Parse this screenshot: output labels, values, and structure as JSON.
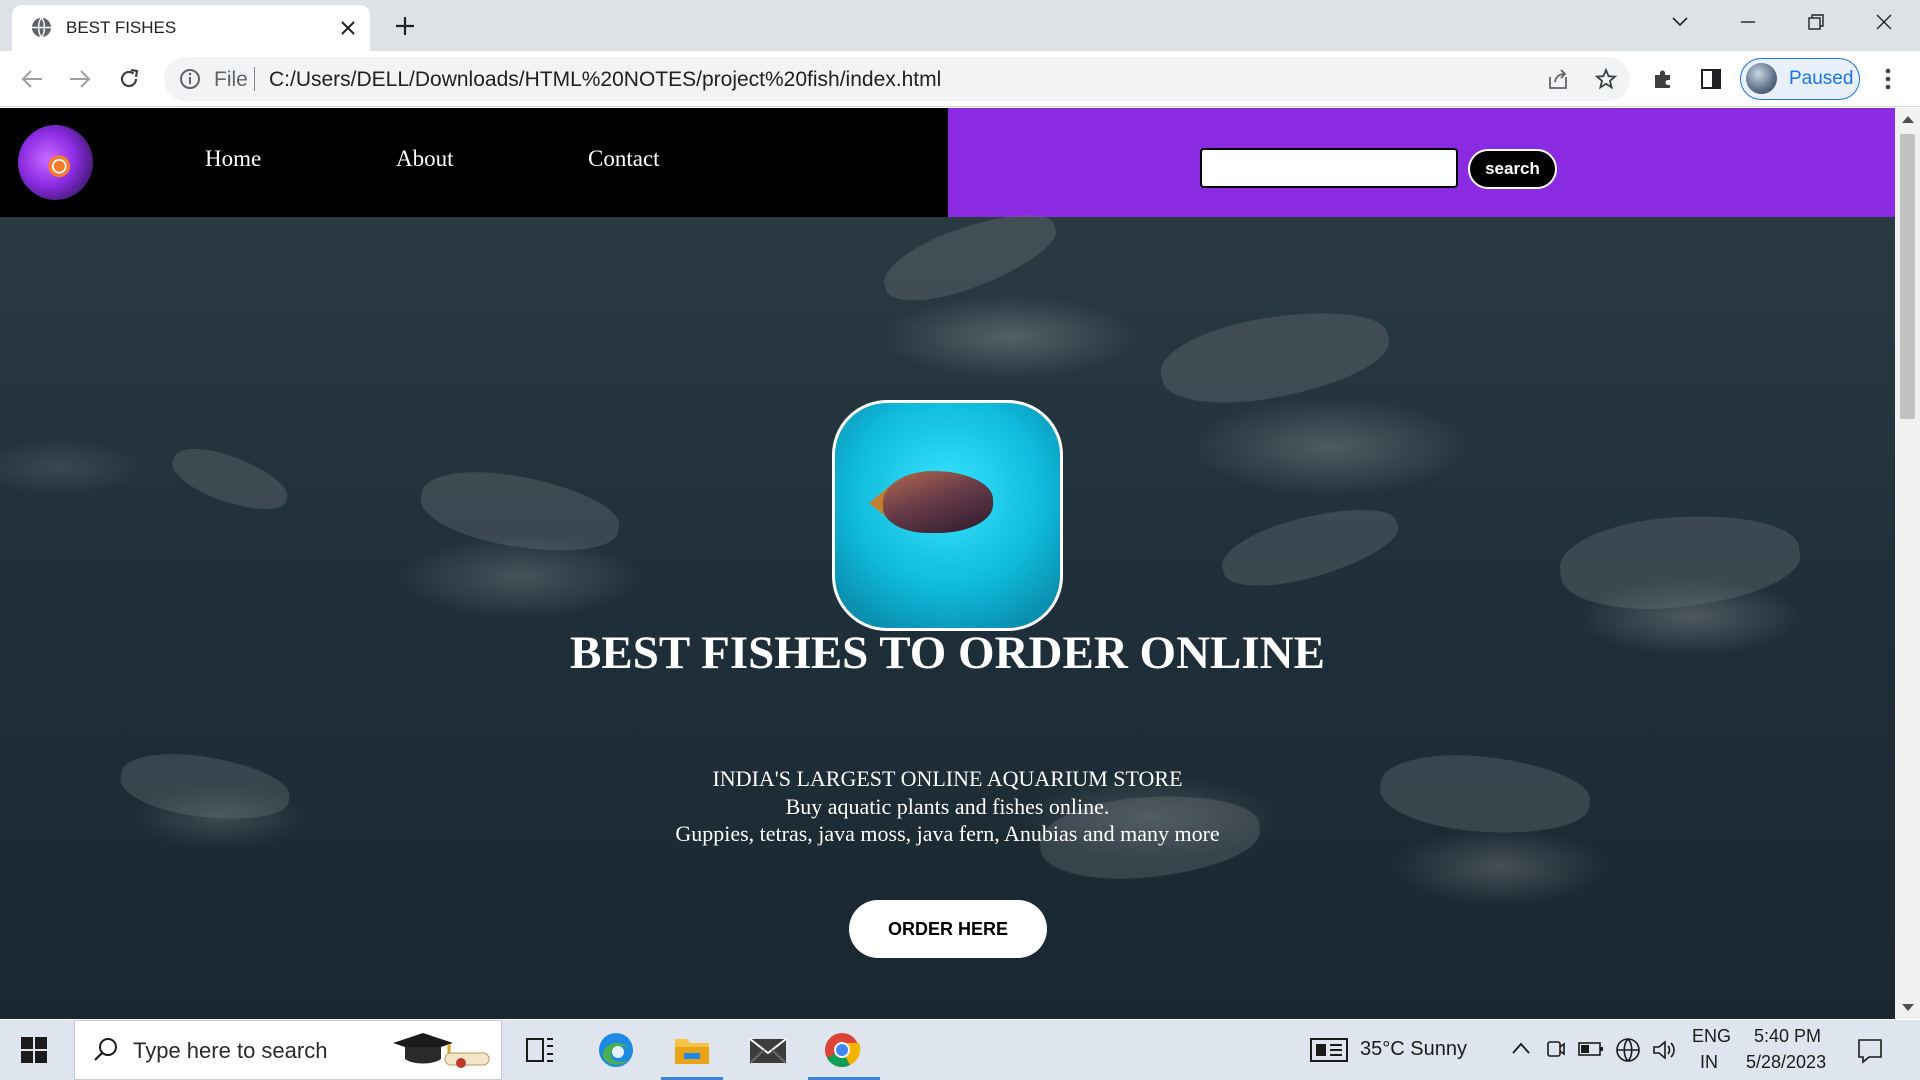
{
  "browser": {
    "tab_title": "BEST FISHES",
    "omnibox_scheme": "File",
    "url": "C:/Users/DELL/Downloads/HTML%20NOTES/project%20fish/index.html",
    "profile_label": "Paused"
  },
  "site": {
    "nav": [
      "Home",
      "About",
      "Contact"
    ],
    "search_button": "search",
    "search_value": "",
    "hero_title": "BEST FISHES TO ORDER ONLINE",
    "hero_subtitle": "INDIA'S LARGEST ONLINE AQUARIUM STORE",
    "hero_line1": "Buy aquatic plants and fishes online.",
    "hero_line2": "Guppies, tetras, java moss, java fern, Anubias and many more",
    "order_button": "ORDER HERE",
    "colors": {
      "nav_bg": "#000000",
      "search_area_bg": "#8a2be2"
    }
  },
  "taskbar": {
    "search_placeholder": "Type here to search",
    "weather": "35°C  Sunny",
    "lang_top": "ENG",
    "lang_bottom": "IN",
    "time": "5:40 PM",
    "date": "5/28/2023"
  }
}
